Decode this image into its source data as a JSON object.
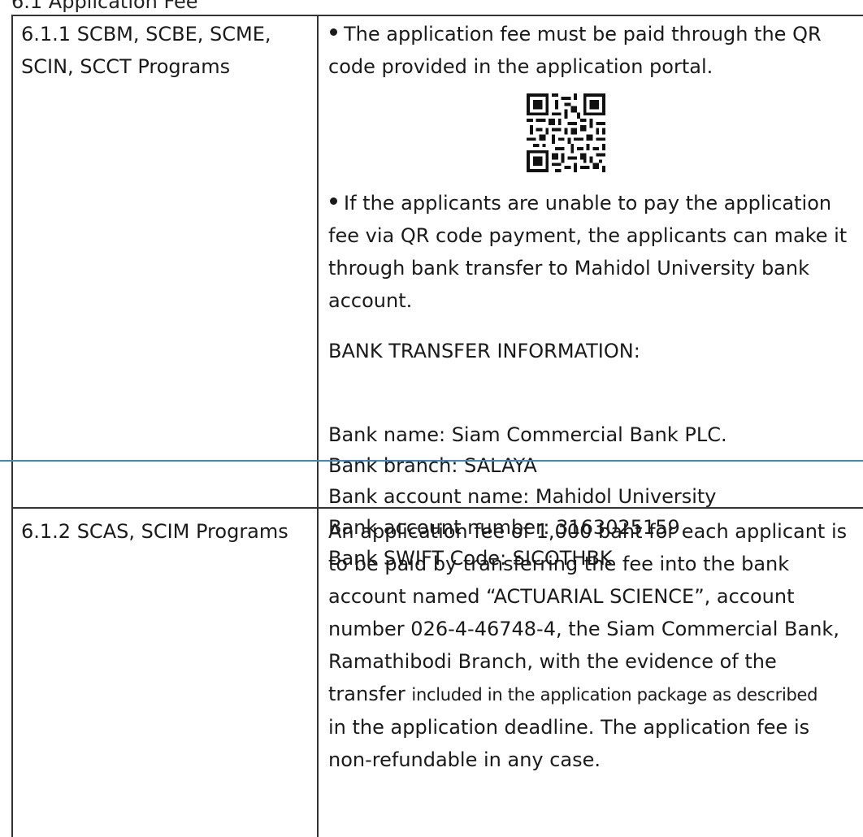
{
  "header_fragment": "6.1 Application Fee",
  "rows": [
    {
      "program": "6.1.1 SCBM, SCBE, SCME, SCIN, SCCT Programs",
      "program_lines": [
        "6.1.1 SCBM, SCBE, SCME,",
        "SCIN, SCCT Programs"
      ],
      "bullet1_lines": [
        "The application fee must be paid through the QR",
        "code provided in the application portal."
      ],
      "qr_icon": "qr-code",
      "bullet2_lines": [
        "If the applicants are unable to pay the application",
        "fee via QR code payment, the applicants can make it",
        "through bank transfer to Mahidol University bank",
        "account."
      ],
      "bank_heading": "BANK TRANSFER INFORMATION:",
      "bank_details": [
        "Bank name: Siam Commercial Bank PLC.",
        "Bank branch: SALAYA",
        "Bank account name: Mahidol University",
        "Bank account number: 3163025159",
        "Bank SWIFT Code: SICOTHBK"
      ]
    },
    {
      "program": "6.1.2 SCAS, SCIM Programs",
      "description_lines": [
        "An application fee of 1,000 baht for each applicant is",
        "to be paid by transferring the fee into the bank",
        "account named “ACTUARIAL SCIENCE”, account",
        "number 026-4-46748-4, the Siam Commercial Bank,",
        "Ramathibodi Branch, with the evidence of the"
      ],
      "transfer_line_start": "transfer",
      "transfer_line_small": "included in the application package as described",
      "description_lines_end": [
        "in the application deadline. The application fee is",
        "non-refundable in any case."
      ]
    }
  ]
}
